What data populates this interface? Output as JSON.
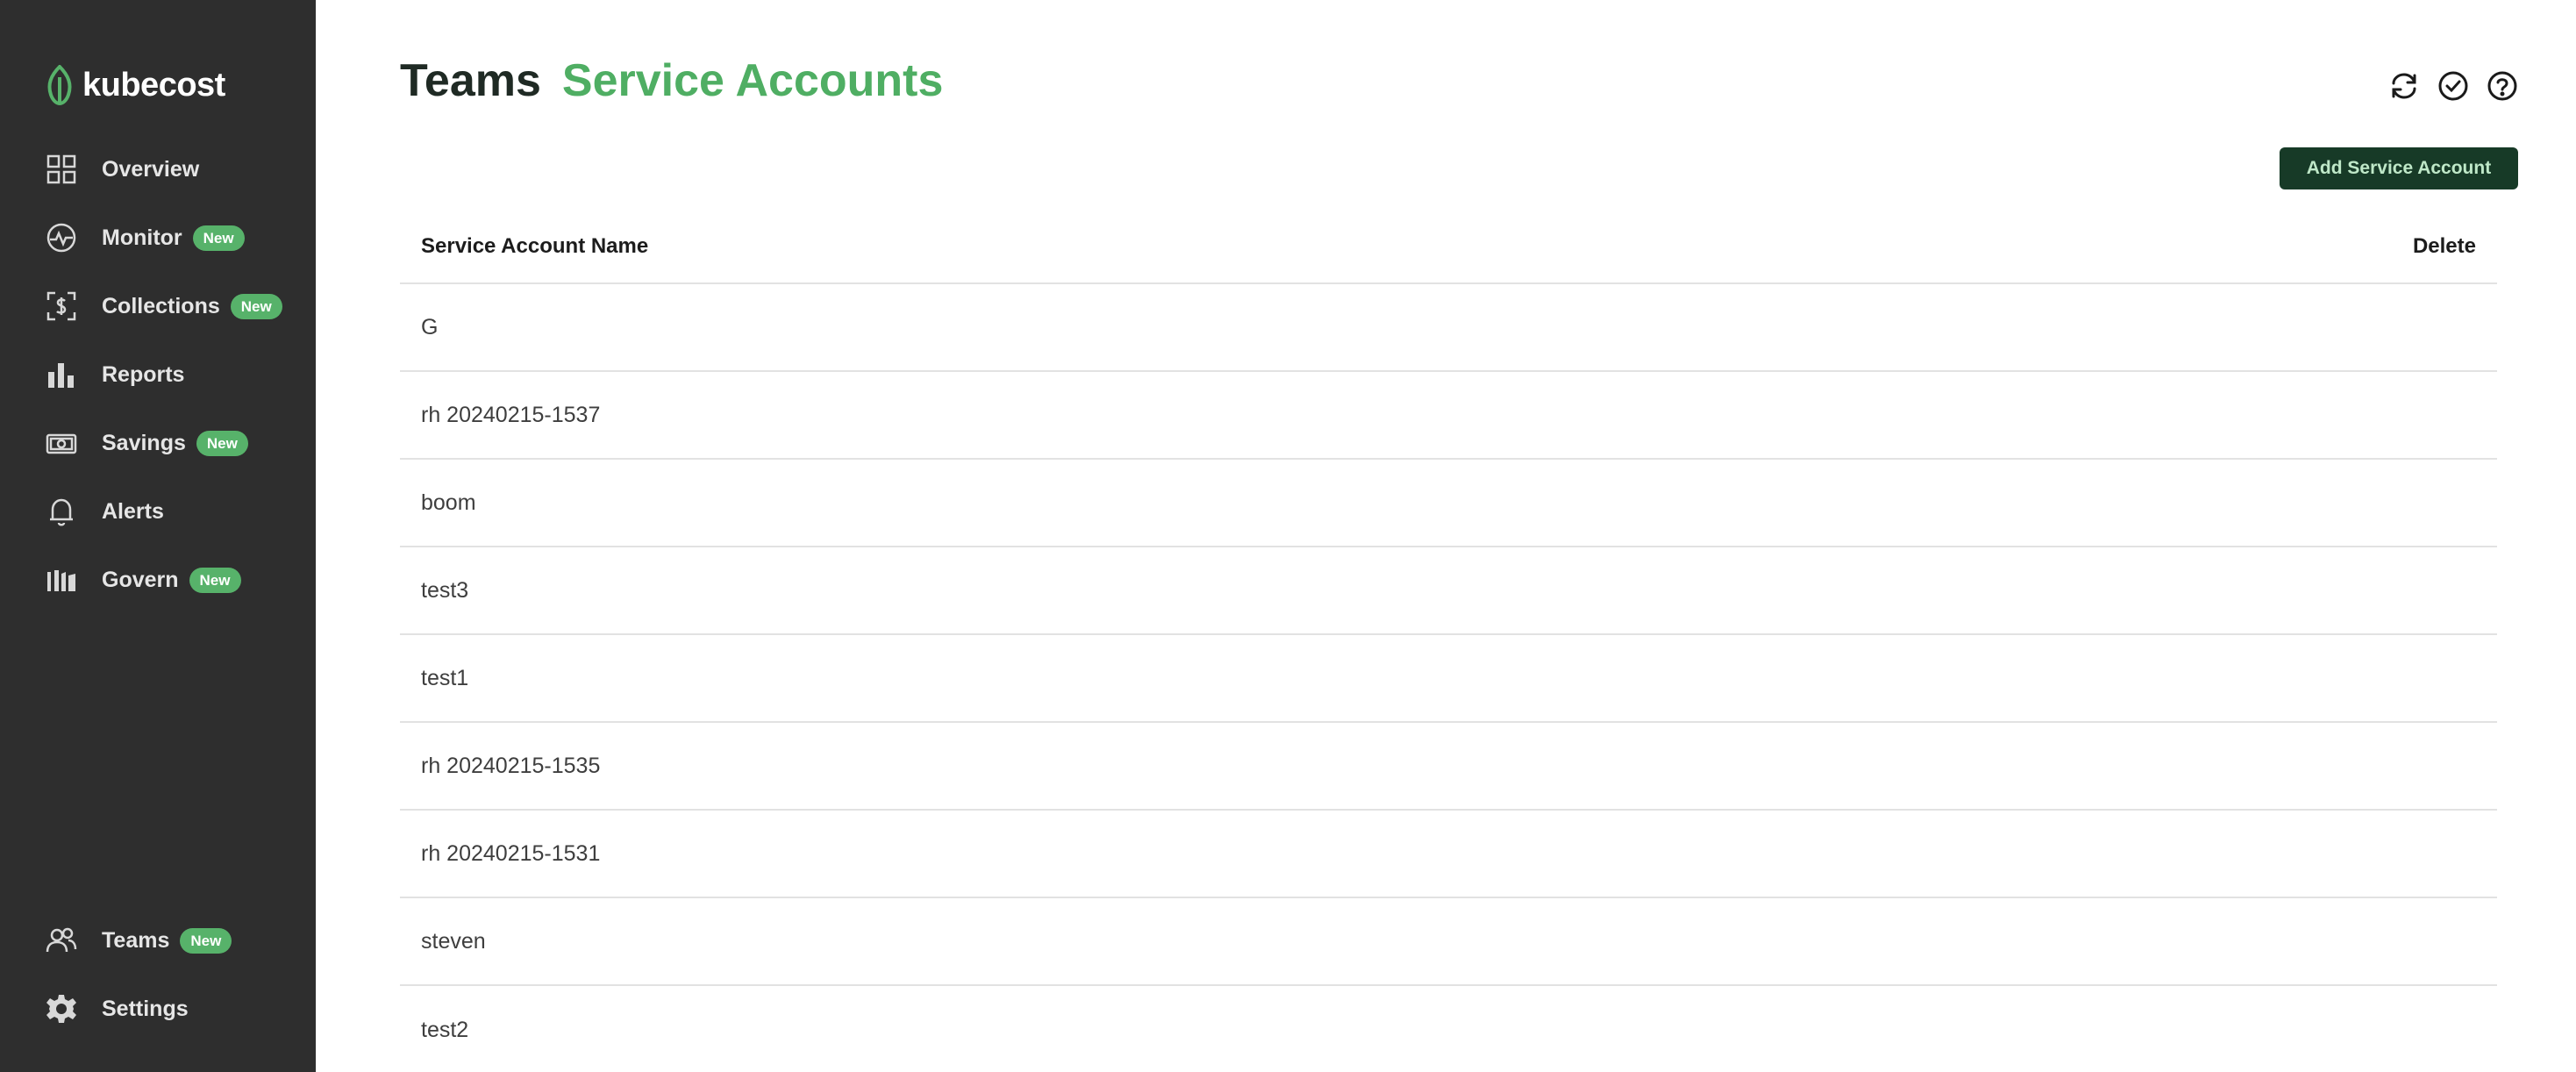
{
  "sidebar": {
    "logo_text": "kubecost",
    "items": [
      {
        "label": "Overview",
        "badge": ""
      },
      {
        "label": "Monitor",
        "badge": "New"
      },
      {
        "label": "Collections",
        "badge": "New"
      },
      {
        "label": "Reports",
        "badge": ""
      },
      {
        "label": "Savings",
        "badge": "New"
      },
      {
        "label": "Alerts",
        "badge": ""
      },
      {
        "label": "Govern",
        "badge": "New"
      }
    ],
    "bottom_items": [
      {
        "label": "Teams",
        "badge": "New"
      },
      {
        "label": "Settings",
        "badge": ""
      }
    ]
  },
  "header": {
    "title": "Teams",
    "subtitle": "Service Accounts",
    "icons": [
      "refresh-icon",
      "check-circle-icon",
      "help-icon"
    ]
  },
  "actions": {
    "add_label": "Add Service Account"
  },
  "table": {
    "columns": [
      "Service Account Name",
      "Delete"
    ],
    "rows": [
      "G",
      "rh 20240215-1537",
      "boom",
      "test3",
      "test1",
      "rh 20240215-1535",
      "rh 20240215-1531",
      "steven",
      "test2"
    ]
  },
  "colors": {
    "sidebar_bg": "#2e2e2e",
    "accent_green": "#4fae63",
    "badge_green": "#57b26a",
    "button_bg": "#173a27"
  }
}
